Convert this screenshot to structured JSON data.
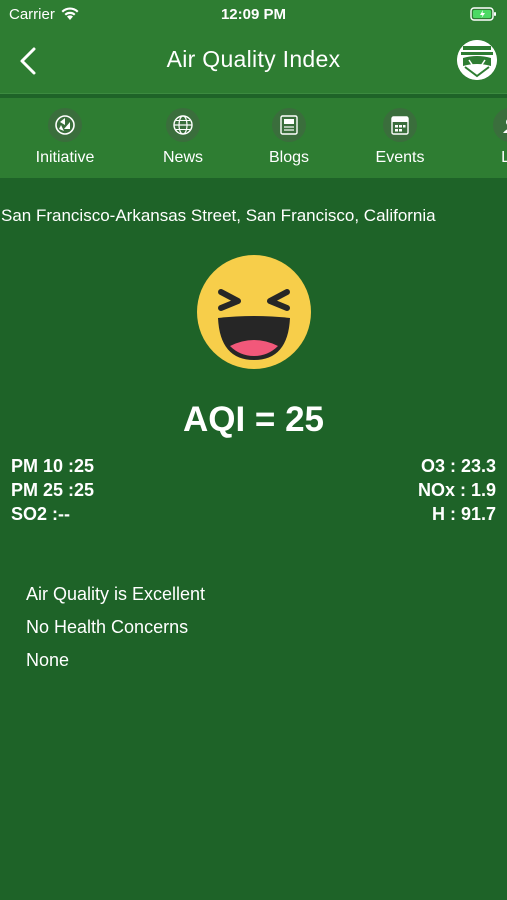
{
  "status_bar": {
    "carrier": "Carrier",
    "time": "12:09 PM"
  },
  "header": {
    "title": "Air Quality Index"
  },
  "tabs": [
    {
      "label": "Initiative",
      "icon": "recycle-icon"
    },
    {
      "label": "News",
      "icon": "globe-icon"
    },
    {
      "label": "Blogs",
      "icon": "document-icon"
    },
    {
      "label": "Events",
      "icon": "calendar-icon"
    },
    {
      "label": "Le",
      "icon": "person-icon"
    }
  ],
  "location": "San Francisco-Arkansas Street, San Francisco, California",
  "aqi": {
    "label": "AQI = 25",
    "value": 25,
    "mood": "laughing-face"
  },
  "pollutants_left": [
    "PM 10 :25",
    "PM 25 :25",
    "SO2 :--"
  ],
  "pollutants_right": [
    "O3 : 23.3",
    "NOx : 1.9",
    "H : 91.7"
  ],
  "advice": [
    "Air Quality is Excellent",
    "No Health Concerns",
    "None"
  ],
  "colors": {
    "background": "#1e6328",
    "bar": "#2e7d32",
    "emoji": "#f7ce4a"
  }
}
